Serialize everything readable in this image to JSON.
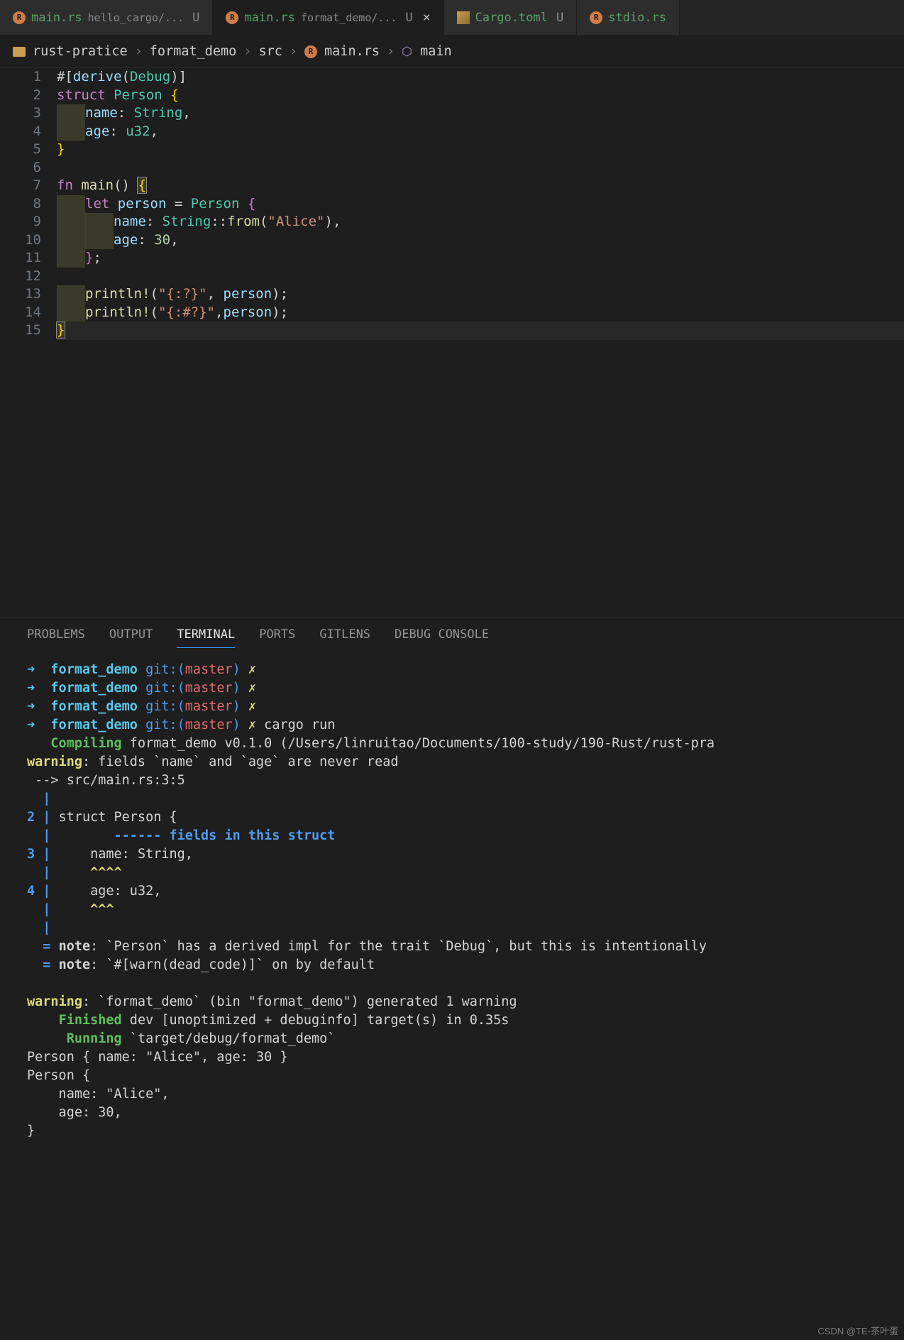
{
  "tabs": [
    {
      "filename": "main.rs",
      "path": "hello_cargo/...",
      "status": "U",
      "active": false,
      "icon": "rust"
    },
    {
      "filename": "main.rs",
      "path": "format_demo/...",
      "status": "U",
      "active": true,
      "icon": "rust"
    },
    {
      "filename": "Cargo.toml",
      "path": "",
      "status": "U",
      "active": false,
      "icon": "toml"
    },
    {
      "filename": "stdio.rs",
      "path": "",
      "status": "",
      "active": false,
      "icon": "rust"
    }
  ],
  "breadcrumb": {
    "parts": [
      "rust-pratice",
      "format_demo",
      "src",
      "main.rs",
      "main"
    ]
  },
  "editor": {
    "lines": [
      {
        "n": 1,
        "tokens": [
          [
            "c-pun",
            "#["
          ],
          [
            "c-attr",
            "derive"
          ],
          [
            "c-pun",
            "("
          ],
          [
            "c-type",
            "Debug"
          ],
          [
            "c-pun",
            ")]"
          ]
        ]
      },
      {
        "n": 2,
        "tokens": [
          [
            "c-kw",
            "struct"
          ],
          [
            "c-pun",
            " "
          ],
          [
            "c-type",
            "Person"
          ],
          [
            "c-pun",
            " "
          ],
          [
            "c-brace",
            "{"
          ]
        ]
      },
      {
        "n": 3,
        "indent": 1,
        "tokens": [
          [
            "c-var",
            "name"
          ],
          [
            "c-pun",
            ": "
          ],
          [
            "c-type",
            "String"
          ],
          [
            "c-pun",
            ","
          ]
        ]
      },
      {
        "n": 4,
        "indent": 1,
        "tokens": [
          [
            "c-var",
            "age"
          ],
          [
            "c-pun",
            ": "
          ],
          [
            "c-type",
            "u32"
          ],
          [
            "c-pun",
            ","
          ]
        ]
      },
      {
        "n": 5,
        "tokens": [
          [
            "c-brace",
            "}"
          ]
        ]
      },
      {
        "n": 6,
        "tokens": []
      },
      {
        "n": 7,
        "tokens": [
          [
            "c-kw",
            "fn"
          ],
          [
            "c-pun",
            " "
          ],
          [
            "c-fn",
            "main"
          ],
          [
            "c-pun",
            "() "
          ],
          [
            "c-brace c-box",
            "{"
          ]
        ]
      },
      {
        "n": 8,
        "indent": 1,
        "tokens": [
          [
            "c-kw",
            "let"
          ],
          [
            "c-pun",
            " "
          ],
          [
            "c-var",
            "person"
          ],
          [
            "c-pun",
            " = "
          ],
          [
            "c-type",
            "Person"
          ],
          [
            "c-pun",
            " "
          ],
          [
            "c-brace2",
            "{"
          ]
        ]
      },
      {
        "n": 9,
        "indent": 2,
        "tokens": [
          [
            "c-var",
            "name"
          ],
          [
            "c-pun",
            ": "
          ],
          [
            "c-type",
            "String"
          ],
          [
            "c-pun",
            "::"
          ],
          [
            "c-fn",
            "from"
          ],
          [
            "c-pun",
            "("
          ],
          [
            "c-str",
            "\"Alice\""
          ],
          [
            "c-pun",
            ")"
          ],
          [
            "c-pun",
            ","
          ]
        ]
      },
      {
        "n": 10,
        "indent": 2,
        "tokens": [
          [
            "c-var",
            "age"
          ],
          [
            "c-pun",
            ": "
          ],
          [
            "c-num",
            "30"
          ],
          [
            "c-pun",
            ","
          ]
        ]
      },
      {
        "n": 11,
        "indent": 1,
        "tokens": [
          [
            "c-brace2",
            "}"
          ],
          [
            "c-pun",
            ";"
          ]
        ]
      },
      {
        "n": 12,
        "tokens": []
      },
      {
        "n": 13,
        "indent": 1,
        "tokens": [
          [
            "c-macro",
            "println!"
          ],
          [
            "c-pun",
            "("
          ],
          [
            "c-str",
            "\"{:?}\""
          ],
          [
            "c-pun",
            ", "
          ],
          [
            "c-var",
            "person"
          ],
          [
            "c-pun",
            ");"
          ]
        ]
      },
      {
        "n": 14,
        "indent": 1,
        "tokens": [
          [
            "c-macro",
            "println!"
          ],
          [
            "c-pun",
            "("
          ],
          [
            "c-str",
            "\"{:#?}\""
          ],
          [
            "c-pun",
            ","
          ],
          [
            "c-var",
            "person"
          ],
          [
            "c-pun",
            ");"
          ]
        ]
      },
      {
        "n": 15,
        "hl": true,
        "tokens": [
          [
            "c-brace c-box",
            "}"
          ]
        ]
      }
    ]
  },
  "panel_tabs": [
    "PROBLEMS",
    "OUTPUT",
    "TERMINAL",
    "PORTS",
    "GITLENS",
    "DEBUG CONSOLE"
  ],
  "panel_active": "TERMINAL",
  "terminal": {
    "prompts": [
      {
        "dir": "format_demo",
        "branch": "master",
        "status": "✗",
        "cmd": ""
      },
      {
        "dir": "format_demo",
        "branch": "master",
        "status": "✗",
        "cmd": ""
      },
      {
        "dir": "format_demo",
        "branch": "master",
        "status": "✗",
        "cmd": ""
      },
      {
        "dir": "format_demo",
        "branch": "master",
        "status": "✗",
        "cmd": "cargo run"
      }
    ],
    "compiling": "format_demo v0.1.0 (/Users/linruitao/Documents/100-study/190-Rust/rust-pra",
    "warning1": ": fields `name` and `age` are never read",
    "loc": " --> src/main.rs:3:5",
    "struct_header": "struct Person {",
    "struct_hint": "------ fields in this struct",
    "field1": "    name: String,",
    "caret1": "    ^^^^",
    "field2": "    age: u32,",
    "caret2": "    ^^^",
    "note1": ": `Person` has a derived impl for the trait `Debug`, but this is intentionally ",
    "note2": ": `#[warn(dead_code)]` on by default",
    "warning2": ": `format_demo` (bin \"format_demo\") generated 1 warning",
    "finished": " dev [unoptimized + debuginfo] target(s) in 0.35s",
    "running": " `target/debug/format_demo`",
    "out1": "Person { name: \"Alice\", age: 30 }",
    "out2a": "Person {",
    "out2b": "    name: \"Alice\",",
    "out2c": "    age: 30,",
    "out2d": "}"
  },
  "watermark": "CSDN @TE-茶叶蛋"
}
